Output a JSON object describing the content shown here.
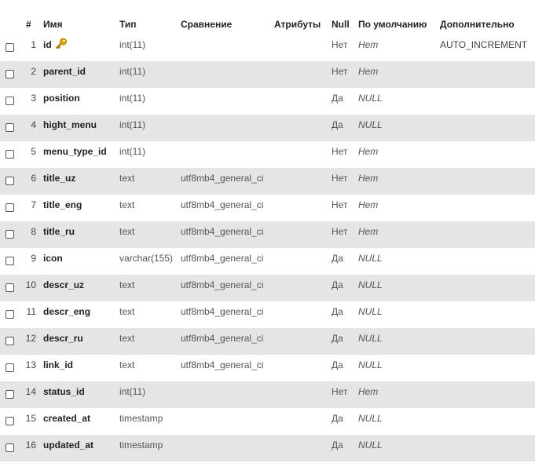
{
  "headers": {
    "num": "#",
    "name": "Имя",
    "type": "Тип",
    "collation": "Сравнение",
    "attributes": "Атрибуты",
    "null": "Null",
    "default": "По умолчанию",
    "extra": "Дополнительно"
  },
  "rows": [
    {
      "num": "1",
      "name": "id",
      "type": "int(11)",
      "collation": "",
      "null": "Нет",
      "default": "Нет",
      "extra": "AUTO_INCREMENT",
      "primary_key_icon": "key-icon"
    },
    {
      "num": "2",
      "name": "parent_id",
      "type": "int(11)",
      "collation": "",
      "null": "Нет",
      "default": "Нет",
      "extra": ""
    },
    {
      "num": "3",
      "name": "position",
      "type": "int(11)",
      "collation": "",
      "null": "Да",
      "default": "NULL",
      "extra": ""
    },
    {
      "num": "4",
      "name": "hight_menu",
      "type": "int(11)",
      "collation": "",
      "null": "Да",
      "default": "NULL",
      "extra": ""
    },
    {
      "num": "5",
      "name": "menu_type_id",
      "type": "int(11)",
      "collation": "",
      "null": "Нет",
      "default": "Нет",
      "extra": ""
    },
    {
      "num": "6",
      "name": "title_uz",
      "type": "text",
      "collation": "utf8mb4_general_ci",
      "null": "Нет",
      "default": "Нет",
      "extra": ""
    },
    {
      "num": "7",
      "name": "title_eng",
      "type": "text",
      "collation": "utf8mb4_general_ci",
      "null": "Нет",
      "default": "Нет",
      "extra": ""
    },
    {
      "num": "8",
      "name": "title_ru",
      "type": "text",
      "collation": "utf8mb4_general_ci",
      "null": "Нет",
      "default": "Нет",
      "extra": ""
    },
    {
      "num": "9",
      "name": "icon",
      "type": "varchar(155)",
      "collation": "utf8mb4_general_ci",
      "null": "Да",
      "default": "NULL",
      "extra": ""
    },
    {
      "num": "10",
      "name": "descr_uz",
      "type": "text",
      "collation": "utf8mb4_general_ci",
      "null": "Да",
      "default": "NULL",
      "extra": ""
    },
    {
      "num": "11",
      "name": "descr_eng",
      "type": "text",
      "collation": "utf8mb4_general_ci",
      "null": "Да",
      "default": "NULL",
      "extra": ""
    },
    {
      "num": "12",
      "name": "descr_ru",
      "type": "text",
      "collation": "utf8mb4_general_ci",
      "null": "Да",
      "default": "NULL",
      "extra": ""
    },
    {
      "num": "13",
      "name": "link_id",
      "type": "text",
      "collation": "utf8mb4_general_ci",
      "null": "Да",
      "default": "NULL",
      "extra": ""
    },
    {
      "num": "14",
      "name": "status_id",
      "type": "int(11)",
      "collation": "",
      "null": "Нет",
      "default": "Нет",
      "extra": ""
    },
    {
      "num": "15",
      "name": "created_at",
      "type": "timestamp",
      "collation": "",
      "null": "Да",
      "default": "NULL",
      "extra": ""
    },
    {
      "num": "16",
      "name": "updated_at",
      "type": "timestamp",
      "collation": "",
      "null": "Да",
      "default": "NULL",
      "extra": ""
    }
  ],
  "colors": {
    "alt_row": "#e5e5e5",
    "key_icon": "#e0a800"
  }
}
